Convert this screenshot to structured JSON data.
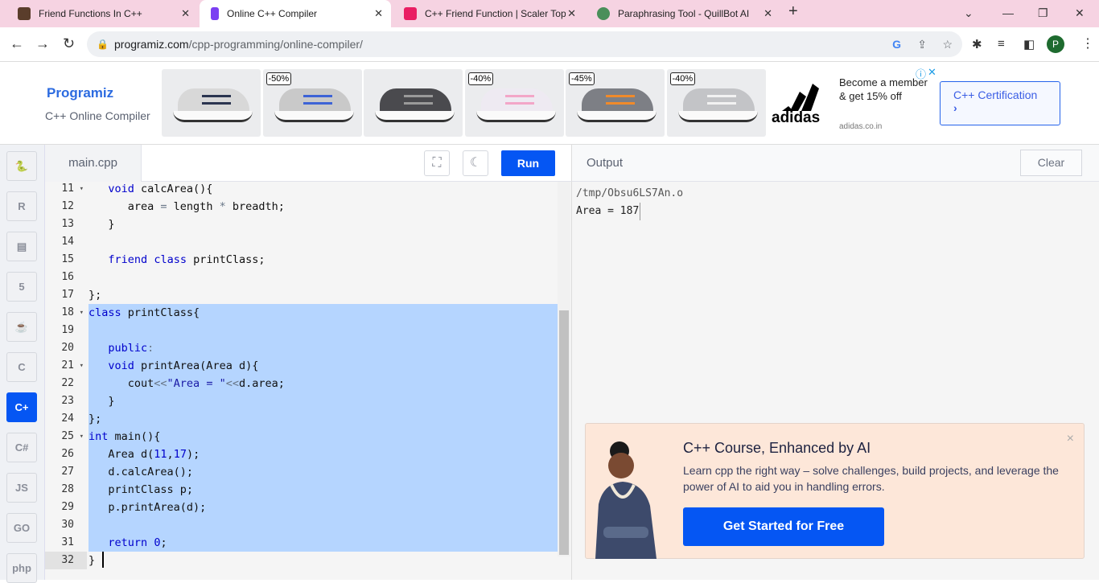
{
  "browser": {
    "tabs": [
      {
        "title": "Friend Functions In C++",
        "active": false,
        "color": "#5a3d2b"
      },
      {
        "title": "Online C++ Compiler",
        "active": true,
        "color": "#7b3ff2"
      },
      {
        "title": "C++ Friend Function | Scaler Top",
        "active": false,
        "color": "#e91e63"
      },
      {
        "title": "Paraphrasing Tool - QuillBot AI",
        "active": false,
        "color": "#4a8f5a"
      }
    ],
    "url_domain": "programiz.com",
    "url_path": "/cpp-programming/online-compiler/",
    "profile_initial": "P"
  },
  "ad": {
    "logo": "Programiz",
    "subtitle": "C++ Online Compiler",
    "discounts": [
      "",
      "-50%",
      "",
      "-40%",
      "-45%",
      "-40%"
    ],
    "brand": "adidas",
    "tagline": "Become a member & get 15% off",
    "domain": "adidas.co.in",
    "cert_button": "C++ Certification",
    "cert_chevron": "›"
  },
  "sidebar": {
    "items": [
      {
        "name": "python",
        "label": "🐍"
      },
      {
        "name": "r",
        "label": "R"
      },
      {
        "name": "sql",
        "label": "▤"
      },
      {
        "name": "html",
        "label": "5"
      },
      {
        "name": "java",
        "label": "☕"
      },
      {
        "name": "c",
        "label": "C"
      },
      {
        "name": "cpp",
        "label": "C+",
        "active": true
      },
      {
        "name": "csharp",
        "label": "C#"
      },
      {
        "name": "js",
        "label": "JS"
      },
      {
        "name": "go",
        "label": "GO"
      },
      {
        "name": "php",
        "label": "php"
      }
    ]
  },
  "editor": {
    "file_tab": "main.cpp",
    "run_label": "Run",
    "lines": [
      {
        "n": 11,
        "fold": true,
        "t": [
          [
            "",
            "   "
          ],
          [
            "kw",
            "void"
          ],
          [
            "",
            " calcArea(){"
          ]
        ]
      },
      {
        "n": 12,
        "t": [
          [
            "",
            "      area "
          ],
          [
            "op",
            "="
          ],
          [
            "",
            " length "
          ],
          [
            "op",
            "*"
          ],
          [
            "",
            " breadth;"
          ]
        ]
      },
      {
        "n": 13,
        "t": [
          [
            "",
            "   }"
          ]
        ]
      },
      {
        "n": 14,
        "t": []
      },
      {
        "n": 15,
        "t": [
          [
            "",
            "   "
          ],
          [
            "kw",
            "friend"
          ],
          [
            "",
            " "
          ],
          [
            "kw",
            "class"
          ],
          [
            "",
            " printClass;"
          ]
        ]
      },
      {
        "n": 16,
        "t": []
      },
      {
        "n": 17,
        "t": [
          [
            "",
            "};"
          ]
        ]
      },
      {
        "n": 18,
        "fold": true,
        "t": [
          [
            "kw",
            "class"
          ],
          [
            "",
            " printClass{"
          ]
        ]
      },
      {
        "n": 19,
        "t": []
      },
      {
        "n": 20,
        "t": [
          [
            "",
            "   "
          ],
          [
            "kw",
            "public"
          ],
          [
            "op",
            ":"
          ]
        ]
      },
      {
        "n": 21,
        "fold": true,
        "t": [
          [
            "",
            "   "
          ],
          [
            "kw",
            "void"
          ],
          [
            "",
            " printArea(Area d){"
          ]
        ]
      },
      {
        "n": 22,
        "t": [
          [
            "",
            "      cout"
          ],
          [
            "op",
            "<<"
          ],
          [
            "str",
            "\"Area = \""
          ],
          [
            "op",
            "<<"
          ],
          [
            "",
            "d.area;"
          ]
        ]
      },
      {
        "n": 23,
        "t": [
          [
            "",
            "   }"
          ]
        ]
      },
      {
        "n": 24,
        "t": [
          [
            "",
            "};"
          ]
        ]
      },
      {
        "n": 25,
        "fold": true,
        "t": [
          [
            "kw",
            "int"
          ],
          [
            "",
            " main(){"
          ]
        ]
      },
      {
        "n": 26,
        "t": [
          [
            "",
            "   Area d("
          ],
          [
            "num",
            "11"
          ],
          [
            "",
            ","
          ],
          [
            "num",
            "17"
          ],
          [
            "",
            ");"
          ]
        ]
      },
      {
        "n": 27,
        "t": [
          [
            "",
            "   d.calcArea();"
          ]
        ]
      },
      {
        "n": 28,
        "t": [
          [
            "",
            "   printClass p;"
          ]
        ]
      },
      {
        "n": 29,
        "t": [
          [
            "",
            "   p.printArea(d);"
          ]
        ]
      },
      {
        "n": 30,
        "t": []
      },
      {
        "n": 31,
        "t": [
          [
            "",
            "   "
          ],
          [
            "kw",
            "return"
          ],
          [
            "",
            " "
          ],
          [
            "num",
            "0"
          ],
          [
            "",
            ";"
          ]
        ]
      },
      {
        "n": 32,
        "active": true,
        "t": [
          [
            "",
            "}"
          ]
        ]
      }
    ],
    "selection_lines": [
      18,
      31
    ]
  },
  "output": {
    "title": "Output",
    "clear_label": "Clear",
    "lines": [
      "/tmp/Obsu6LS7An.o",
      "Area = 187"
    ]
  },
  "promo": {
    "title": "C++ Course, Enhanced by AI",
    "description": "Learn cpp the right way – solve challenges, build projects, and leverage the power of AI to aid you in handling errors.",
    "cta": "Get Started for Free",
    "close": "×"
  }
}
